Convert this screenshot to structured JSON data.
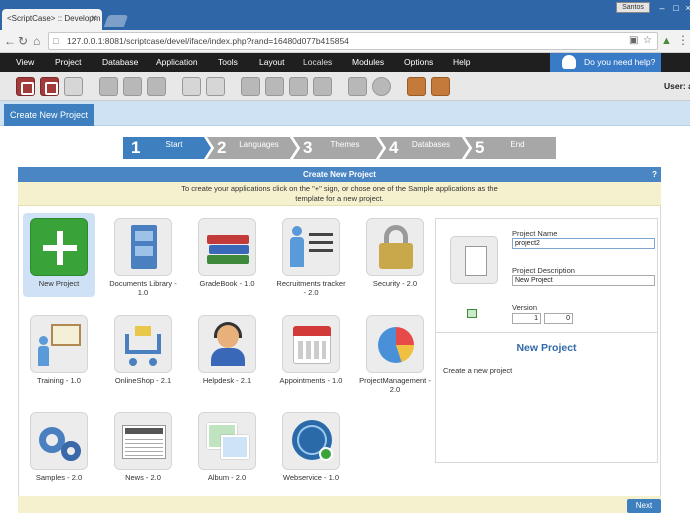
{
  "browser": {
    "tab_title": "<ScriptCase> :: Developm",
    "tab_close": "×",
    "user_badge": "Santos",
    "url": "127.0.0.1:8081/scriptcase/devel/iface/index.php?rand=16480d077b415854"
  },
  "menu": {
    "items": [
      "View",
      "Project",
      "Database",
      "Application",
      "Tools",
      "Layout",
      "Locales",
      "Modules",
      "Options",
      "Help"
    ],
    "help_button": "Do you need help?"
  },
  "toolbar": {
    "user_label": "User: a"
  },
  "page": {
    "tab_label": "Create New Project"
  },
  "wizard": {
    "steps": [
      {
        "num": "1",
        "label": "Start"
      },
      {
        "num": "2",
        "label": "Languages"
      },
      {
        "num": "3",
        "label": "Themes"
      },
      {
        "num": "4",
        "label": "Databases"
      },
      {
        "num": "5",
        "label": "End"
      }
    ]
  },
  "panel": {
    "title": "Create New Project",
    "help_mark": "?",
    "instruction_line1": "To create your applications click on the \"+\" sign, or chose one of the Sample applications as the",
    "instruction_line2": "template for a new project."
  },
  "samples": [
    {
      "label": "New Project"
    },
    {
      "label": "Documents Library - 1.0"
    },
    {
      "label": "GradeBook - 1.0"
    },
    {
      "label": "Recruitments tracker - 2.0"
    },
    {
      "label": "Security - 2.0"
    },
    {
      "label": "Training - 1.0"
    },
    {
      "label": "OnlineShop - 2.1"
    },
    {
      "label": "Helpdesk - 2.1"
    },
    {
      "label": "Appointments - 1.0"
    },
    {
      "label": "ProjectManagement - 2.0"
    },
    {
      "label": "Samples - 2.0"
    },
    {
      "label": "News - 2.0"
    },
    {
      "label": "Album - 2.0"
    },
    {
      "label": "Webservice - 1.0"
    }
  ],
  "form": {
    "project_name_label": "Project Name",
    "project_name_value": "project2",
    "project_description_label": "Project Description",
    "project_description_value": "New Project",
    "version_label": "Version",
    "version_major": "1",
    "version_minor": "0",
    "preview_title": "New Project",
    "preview_description": "Create a new project"
  },
  "footer": {
    "next_label": "Next"
  }
}
